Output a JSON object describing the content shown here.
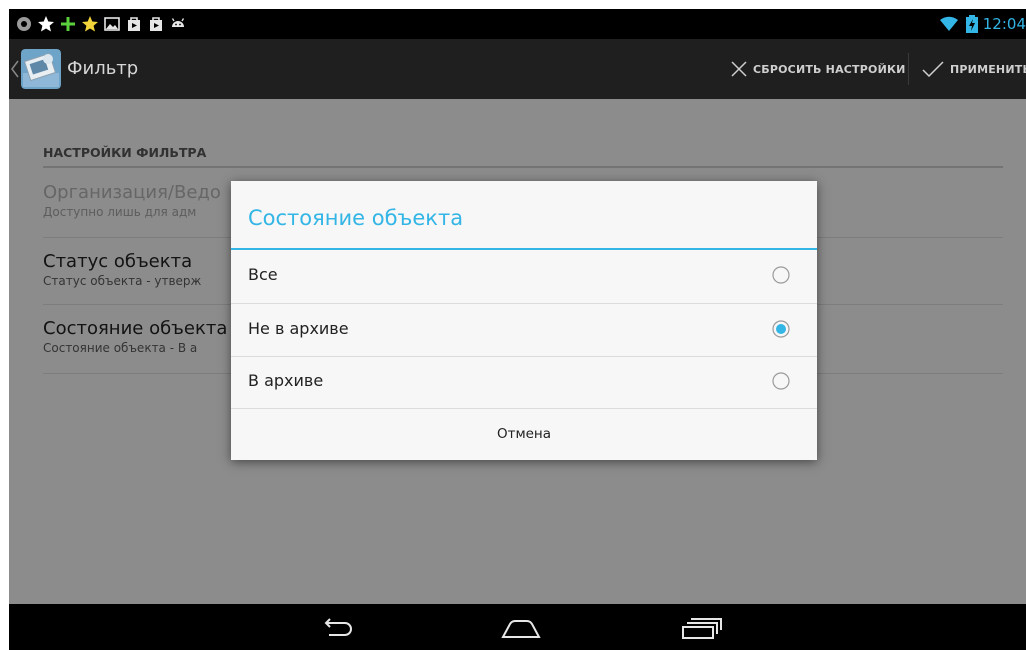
{
  "status_bar": {
    "time": "12:04",
    "left_icons": [
      "location-icon",
      "star-icon",
      "plus-icon",
      "star-icon",
      "image-icon",
      "bag-icon",
      "bag-icon",
      "android-icon"
    ],
    "right_icons": [
      "wifi-icon",
      "battery-charging-icon"
    ]
  },
  "action_bar": {
    "title": "Фильтр",
    "reset_label": "СБРОСИТЬ НАСТРОЙКИ",
    "apply_label": "ПРИМЕНИТЬ"
  },
  "settings": {
    "section_header": "НАСТРОЙКИ ФИЛЬТРА",
    "items": [
      {
        "title": "Организация/Ведо",
        "summary": "Доступно лишь для адм",
        "enabled": false
      },
      {
        "title": "Статус объекта",
        "summary": "Статус объекта - утверж",
        "enabled": true
      },
      {
        "title": "Состояние объекта",
        "summary": "Состояние объекта - В а",
        "enabled": true
      }
    ]
  },
  "dialog": {
    "title": "Состояние объекта",
    "options": [
      {
        "label": "Все",
        "selected": false
      },
      {
        "label": "Не в архиве",
        "selected": true
      },
      {
        "label": "В архиве",
        "selected": false
      }
    ],
    "cancel_label": "Отмена"
  },
  "colors": {
    "accent": "#33b5e5",
    "action_bar": "#1f1f1f",
    "background": "#f2f2f2"
  }
}
